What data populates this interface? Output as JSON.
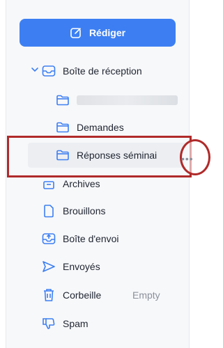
{
  "compose": {
    "label": "Rédiger"
  },
  "folders": {
    "inbox": {
      "label": "Boîte de réception"
    },
    "demandes": {
      "label": "Demandes"
    },
    "reponses": {
      "label": "Réponses séminai"
    },
    "archives": {
      "label": "Archives"
    },
    "drafts": {
      "label": "Brouillons"
    },
    "outbox": {
      "label": "Boîte d'envoi"
    },
    "sent": {
      "label": "Envoyés"
    },
    "trash": {
      "label": "Corbeille",
      "action": "Empty"
    },
    "spam": {
      "label": "Spam"
    }
  },
  "more_glyph": "•••",
  "colors": {
    "accent": "#3d7ff2",
    "highlight": "#b02a2a",
    "muted": "#8b909b"
  }
}
